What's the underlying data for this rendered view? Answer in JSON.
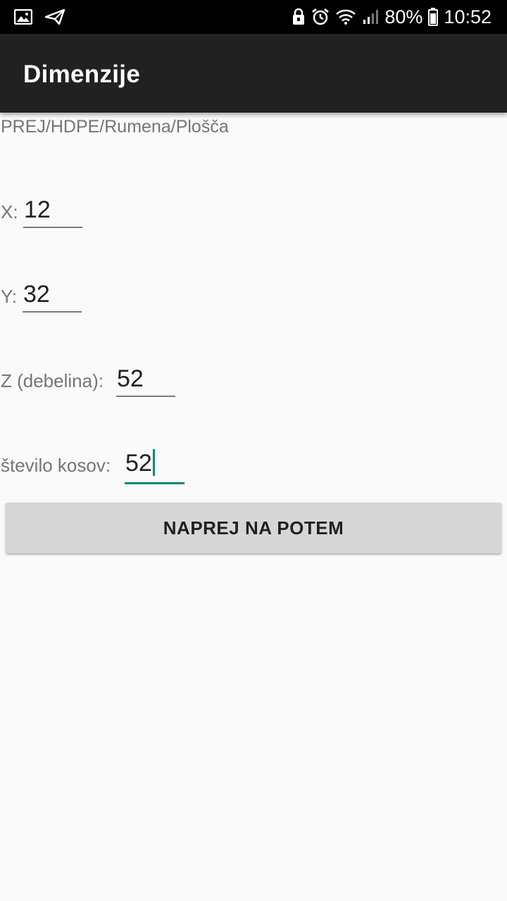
{
  "status_bar": {
    "battery_percent": "80%",
    "time": "10:52",
    "left_icons": [
      "image-icon",
      "send-icon"
    ],
    "right_icons": [
      "lock-icon",
      "alarm-icon",
      "wifi-icon",
      "signal-icon",
      "battery-icon"
    ],
    "background": "#000000"
  },
  "app_bar": {
    "title": "Dimenzije",
    "background": "#212121"
  },
  "path": "PREJ/HDPE/Rumena/Plošča",
  "fields": {
    "x": {
      "label": "X:",
      "value": "12"
    },
    "y": {
      "label": "Y:",
      "value": "32"
    },
    "z": {
      "label": "Z (debelina):",
      "value": "52"
    },
    "count": {
      "label": "število kosov:",
      "value": "52"
    }
  },
  "button": {
    "label": "NAPREJ NA POTEM",
    "background": "#d6d6d6"
  },
  "colors": {
    "accent": "#00897b",
    "page_background": "#fafafa"
  }
}
